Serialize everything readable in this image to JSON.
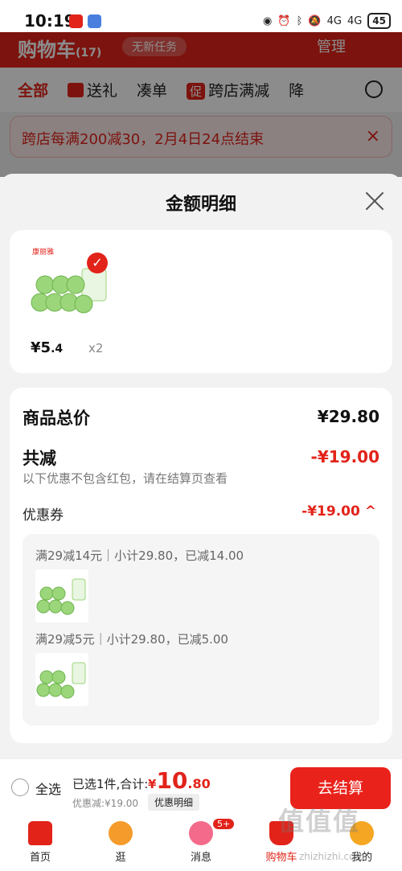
{
  "status_bar": {
    "time": "10:19",
    "network_1": "4G",
    "network_2": "4G",
    "battery": "45"
  },
  "background": {
    "header_title": "购物车",
    "header_count": "(17)",
    "address": "无新任务",
    "manage": "管理",
    "filters": [
      "全部",
      "送礼",
      "凑单",
      "跨店满减",
      "降"
    ],
    "promo_icon": "促",
    "banner_text": "跨店每满200减30，2月4日24点结束",
    "banner_close": "×"
  },
  "sheet": {
    "title": "金额明细",
    "product": {
      "brand": "康丽雅",
      "price_int": "¥5",
      "price_dec": ".4",
      "quantity": "x2"
    },
    "summary": {
      "total_label": "商品总价",
      "total_value": "¥29.80",
      "reduce_label": "共减",
      "reduce_value": "-¥19.00",
      "note": "以下优惠不包含红包，请在结算页查看",
      "coupon_label": "优惠券",
      "coupon_value": "-¥19.00 ^"
    },
    "coupons": [
      {
        "text": "满29减14元｜小计29.80，已减14.00"
      },
      {
        "text": "满29减5元｜小计29.80，已减5.00"
      }
    ]
  },
  "bottom_bar": {
    "select_all": "全选",
    "selected": "已选1件,合计:",
    "currency": "¥",
    "total_int": "10",
    "total_dec": ".80",
    "discount": "优惠减:¥19.00",
    "detail_button": "优惠明细",
    "checkout": "去结算"
  },
  "tabs": [
    {
      "label": "首页"
    },
    {
      "label": "逛"
    },
    {
      "label": "消息",
      "badge": "5+"
    },
    {
      "label": "购物车"
    },
    {
      "label": "我的"
    }
  ],
  "watermark": {
    "text": "值值值",
    "sub": "zhizhizhi.com"
  },
  "colors": {
    "brand_red": "#e2231a",
    "product_green": "#9bd67a"
  }
}
